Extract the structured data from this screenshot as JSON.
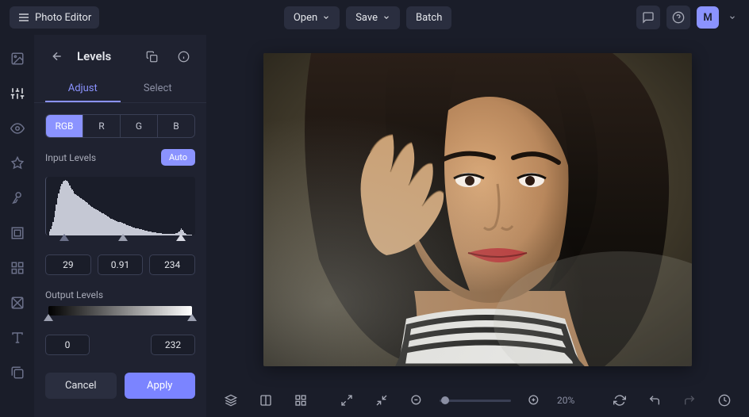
{
  "header": {
    "app_title": "Photo Editor",
    "open": "Open",
    "save": "Save",
    "batch": "Batch",
    "avatar_letter": "M"
  },
  "panel": {
    "title": "Levels",
    "tab_adjust": "Adjust",
    "tab_select": "Select",
    "channels": {
      "rgb": "RGB",
      "r": "R",
      "g": "G",
      "b": "B"
    },
    "input_levels_label": "Input Levels",
    "auto_label": "Auto",
    "input_shadow": "29",
    "input_mid": "0.91",
    "input_high": "234",
    "output_levels_label": "Output Levels",
    "output_low": "0",
    "output_high": "232",
    "cancel": "Cancel",
    "apply": "Apply",
    "histogram": [
      5,
      8,
      12,
      18,
      24,
      32,
      40,
      48,
      55,
      60,
      64,
      67,
      70,
      71,
      72,
      71,
      70,
      68,
      65,
      62,
      60,
      58,
      55,
      53,
      52,
      51,
      50,
      49,
      48,
      47,
      46,
      45,
      44,
      43,
      42,
      40,
      39,
      38,
      37,
      36,
      35,
      34,
      34,
      33,
      32,
      31,
      30,
      29,
      29,
      28,
      27,
      26,
      25,
      24,
      23,
      22,
      22,
      21,
      20,
      20,
      19,
      18,
      18,
      17,
      17,
      16,
      15,
      15,
      14,
      13,
      13,
      12,
      12,
      11,
      11,
      10,
      10,
      9,
      9,
      9,
      8,
      8,
      8,
      7,
      7,
      6,
      6,
      6,
      5,
      5,
      5,
      5,
      4,
      4,
      4,
      4,
      3,
      3,
      3,
      3,
      3,
      2,
      2,
      2,
      2,
      2,
      2,
      2,
      2,
      2,
      2,
      2,
      2,
      3,
      3,
      4,
      5,
      7,
      9,
      7,
      5,
      3,
      2,
      1,
      1,
      1,
      1,
      1
    ]
  },
  "footer": {
    "zoom": "20%"
  }
}
